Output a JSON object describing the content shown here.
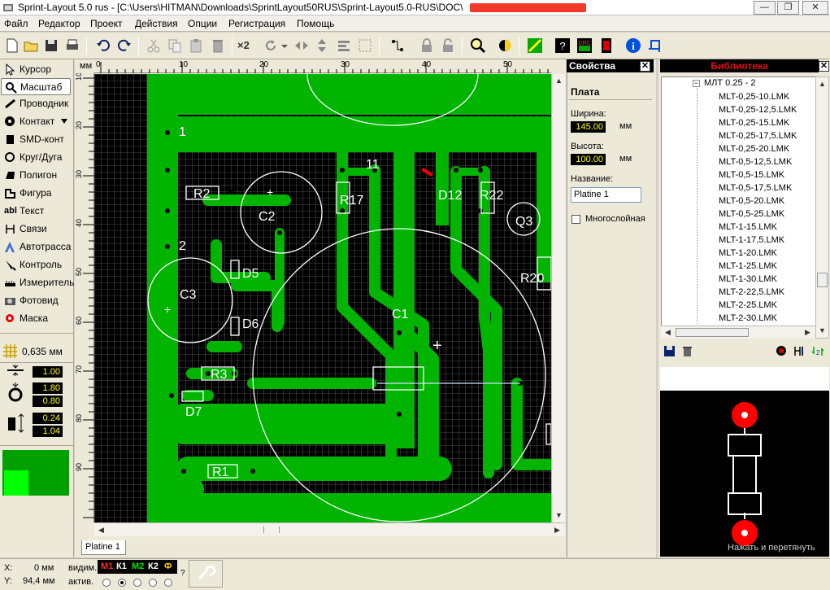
{
  "window": {
    "title": "Sprint-Layout 5.0 rus   - [C:\\Users\\HITMAN\\Downloads\\SprintLayout50RUS\\Sprint-Layout5.0-RUS\\DOC\\",
    "min": "—",
    "max": "❐",
    "close": "✕"
  },
  "menu": [
    "Файл",
    "Редактор",
    "Проект",
    "Действия",
    "Опции",
    "Регистрация",
    "Помощь"
  ],
  "toolbar": {
    "x2": "×2"
  },
  "tools": [
    "Курсор",
    "Масштаб",
    "Проводник",
    "Контакт",
    "SMD-конт",
    "Круг/Дуга",
    "Полигон",
    "Фигура",
    "Текст",
    "Связи",
    "Автотрасса",
    "Контроль",
    "Измеритель",
    "Фотовид",
    "Маска"
  ],
  "grid": {
    "value": "0,635 мм"
  },
  "widths": {
    "track": "1.00",
    "pad_outer": "1.80",
    "pad_inner": "0.80",
    "smd_w": "0.24",
    "smd_h": "1.04"
  },
  "ruler": {
    "unit": "мм",
    "top": [
      "0",
      "10",
      "20",
      "30",
      "40",
      "50"
    ],
    "left": [
      "10",
      "20",
      "30",
      "40",
      "50",
      "60",
      "70",
      "80",
      "90"
    ]
  },
  "board": {
    "labels": [
      "1",
      "R2",
      "C2",
      "11",
      "R17",
      "D12",
      "R22",
      "Q3",
      "2",
      "D5",
      "C3",
      "R20",
      "C1",
      "D6",
      "R3",
      "D7",
      "R1",
      "+",
      "+",
      "+"
    ]
  },
  "tabs": {
    "platine": "Platine 1"
  },
  "properties": {
    "title": "Свойства",
    "section": "Плата",
    "width_label": "Ширина:",
    "width_value": "145.00",
    "height_label": "Высота:",
    "height_value": "100.00",
    "unit": "мм",
    "name_label": "Название:",
    "name_value": "Platine 1",
    "multilayer_label": "Многослойная"
  },
  "library": {
    "title": "Библиотека",
    "group": "МЛТ 0.25 - 2",
    "items": [
      "MLT-0,25-10.LMK",
      "MLT-0,25-12,5.LMK",
      "MLT-0,25-15.LMK",
      "MLT-0,25-17,5.LMK",
      "MLT-0,25-20.LMK",
      "MLT-0,5-12,5.LMK",
      "MLT-0,5-15.LMK",
      "MLT-0,5-17,5.LMK",
      "MLT-0,5-20.LMK",
      "MLT-0,5-25.LMK",
      "MLT-1-15.LMK",
      "MLT-1-17,5.LMK",
      "MLT-1-20.LMK",
      "MLT-1-25.LMK",
      "MLT-1-30.LMK",
      "MLT-2-22,5.LMK",
      "MLT-2-25.LMK",
      "MLT-2-30.LMK"
    ],
    "hint": "Нажать и перетянуть"
  },
  "status": {
    "x_label": "X:",
    "x_value": "0 мм",
    "y_label": "Y:",
    "y_value": "94,4 мм",
    "visible_label": "видим.",
    "active_label": "актив.",
    "layers": [
      "М1",
      "К1",
      "М2",
      "К2",
      "Ф"
    ],
    "help": "?"
  },
  "colors": {
    "copper": "#00b400",
    "board_bg": "#000000",
    "silk": "#ffffff",
    "accent_blue": "#0a246a"
  }
}
